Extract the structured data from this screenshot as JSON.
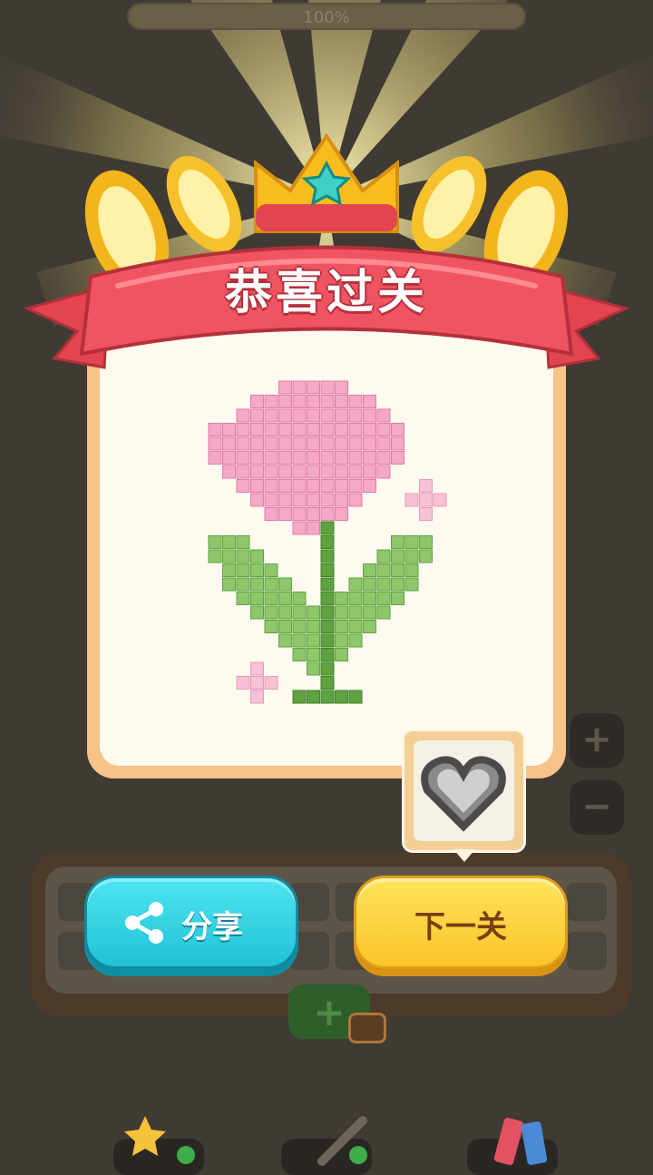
{
  "progress": {
    "label": "100%",
    "value": 1.0
  },
  "banner": {
    "title": "恭喜过关"
  },
  "card": {
    "image": "pixel-tulip",
    "colors": {
      "petal": "#f4a9c6",
      "petal_dark": "#e27ba6",
      "leaf": "#8fc56b",
      "leaf_dark": "#5ea33f"
    }
  },
  "zoom": {
    "in_label": "+",
    "out_label": "−"
  },
  "preview": {
    "image": "pixel-heart"
  },
  "buttons": {
    "share": "分享",
    "next": "下一关"
  },
  "add_slot": {
    "label": "+"
  },
  "tools": [
    "star-tool-icon",
    "brush-tool-icon",
    "eraser-tool-icon"
  ],
  "colors": {
    "background": "#3f3a34",
    "share_button": "#2fd2e3",
    "next_button": "#fdd43c",
    "banner_red": "#e24550",
    "gold": "#f7bd1f"
  }
}
